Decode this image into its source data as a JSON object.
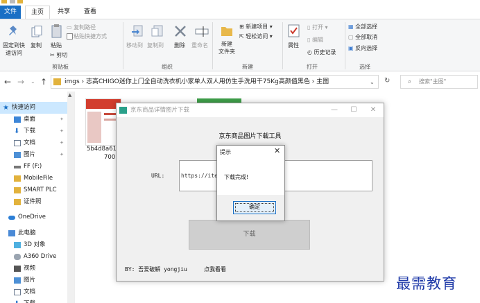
{
  "tabs": {
    "file": "文件",
    "home": "主页",
    "share": "共享",
    "view": "查看"
  },
  "ribbon": {
    "clipboard": {
      "pin": "固定到快\n速访问",
      "copy": "复制",
      "paste": "粘贴",
      "copy_path": "复制路径",
      "paste_shortcut": "粘贴快捷方式",
      "cut": "剪切",
      "label": "剪贴板"
    },
    "organize": {
      "move_to": "移动到",
      "copy_to": "复制到",
      "delete": "删除",
      "rename": "重命名",
      "label": "组织"
    },
    "new": {
      "new_folder": "新建\n文件夹",
      "new_item": "新建项目",
      "easy_access": "轻松访问",
      "label": "新建"
    },
    "open": {
      "properties": "属性",
      "open": "打开",
      "edit": "编辑",
      "history": "历史记录",
      "label": "打开"
    },
    "select": {
      "select_all": "全部选择",
      "select_none": "全部取消",
      "invert": "反向选择",
      "label": "选择"
    }
  },
  "address": {
    "path": "imgs  ›  志高CHIGO迷你上门全自动洗衣机小家单人双人用仿生手洗用干75Kg高颜值黑色  ›  主图",
    "search_placeholder": "搜索\"主图\""
  },
  "nav": {
    "quick_access": "快速访问",
    "items": [
      "桌面",
      "下载",
      "文档",
      "图片",
      "FF (F:)",
      "MobileFile",
      "SMART PLC",
      "证件照"
    ],
    "onedrive": "OneDrive",
    "this_pc": "此电脑",
    "pc_items": [
      "3D 对象",
      "A360 Drive",
      "视频",
      "图片",
      "文档",
      "下载"
    ]
  },
  "files": {
    "item1_name": "5b4d8a61a",
    "item1_sub": "700"
  },
  "dialog": {
    "title": "京东商品详情图片下载",
    "heading": "京东商品图片下载工具",
    "url_label": "URL:",
    "url_value": "https://item",
    "download": "下载",
    "byline": "BY: 吾爱破解 yongjiu",
    "visit": "点我看看"
  },
  "message": {
    "title": "提示",
    "text": "下载完成!",
    "ok": "确定"
  },
  "watermark": "最需教育",
  "colors": {
    "accent": "#1a6fc5",
    "selection": "#cce8ff",
    "folder": "#e2b23c",
    "watermark": "#1f3aa8"
  }
}
